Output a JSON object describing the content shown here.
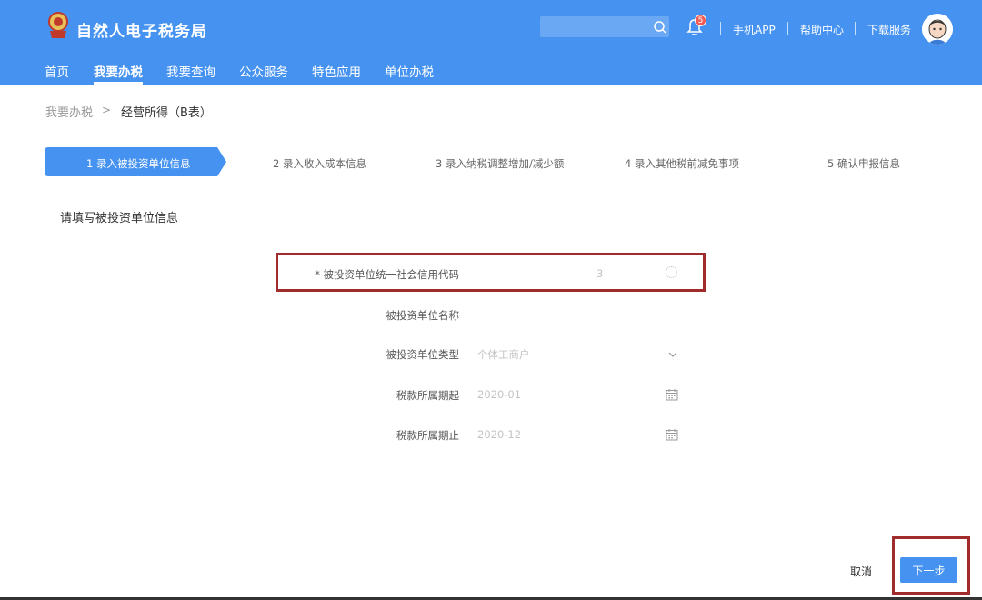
{
  "header": {
    "site_title": "自然人电子税务局",
    "notification_count": "5",
    "links": [
      "手机APP",
      "帮助中心",
      "下载服务"
    ],
    "search_placeholder": ""
  },
  "nav": {
    "items": [
      "首页",
      "我要办税",
      "我要查询",
      "公众服务",
      "特色应用",
      "单位办税"
    ],
    "active": "我要办税"
  },
  "breadcrumb": {
    "parent": "我要办税",
    "separator": ">",
    "current": "经营所得（B表）"
  },
  "steps": [
    "1 录入被投资单位信息",
    "2 录入收入成本信息",
    "3 录入纳税调整增加/减少额",
    "4 录入其他税前减免事项",
    "5 确认申报信息"
  ],
  "section_title": "请填写被投资单位信息",
  "form": {
    "credit_code_label": "* 被投资单位统一社会信用代码",
    "credit_code_value": "3",
    "name_label": "被投资单位名称",
    "name_value": "",
    "type_label": "被投资单位类型",
    "type_value": "个体工商户",
    "period_start_label": "税款所属期起",
    "period_start_value": "2020-01",
    "period_end_label": "税款所属期止",
    "period_end_value": "2020-12"
  },
  "footer": {
    "cancel_label": "取消",
    "next_label": "下一步"
  },
  "colors": {
    "primary": "#4592f0",
    "highlight_border": "#a12c2c",
    "badge": "#f25c54"
  }
}
